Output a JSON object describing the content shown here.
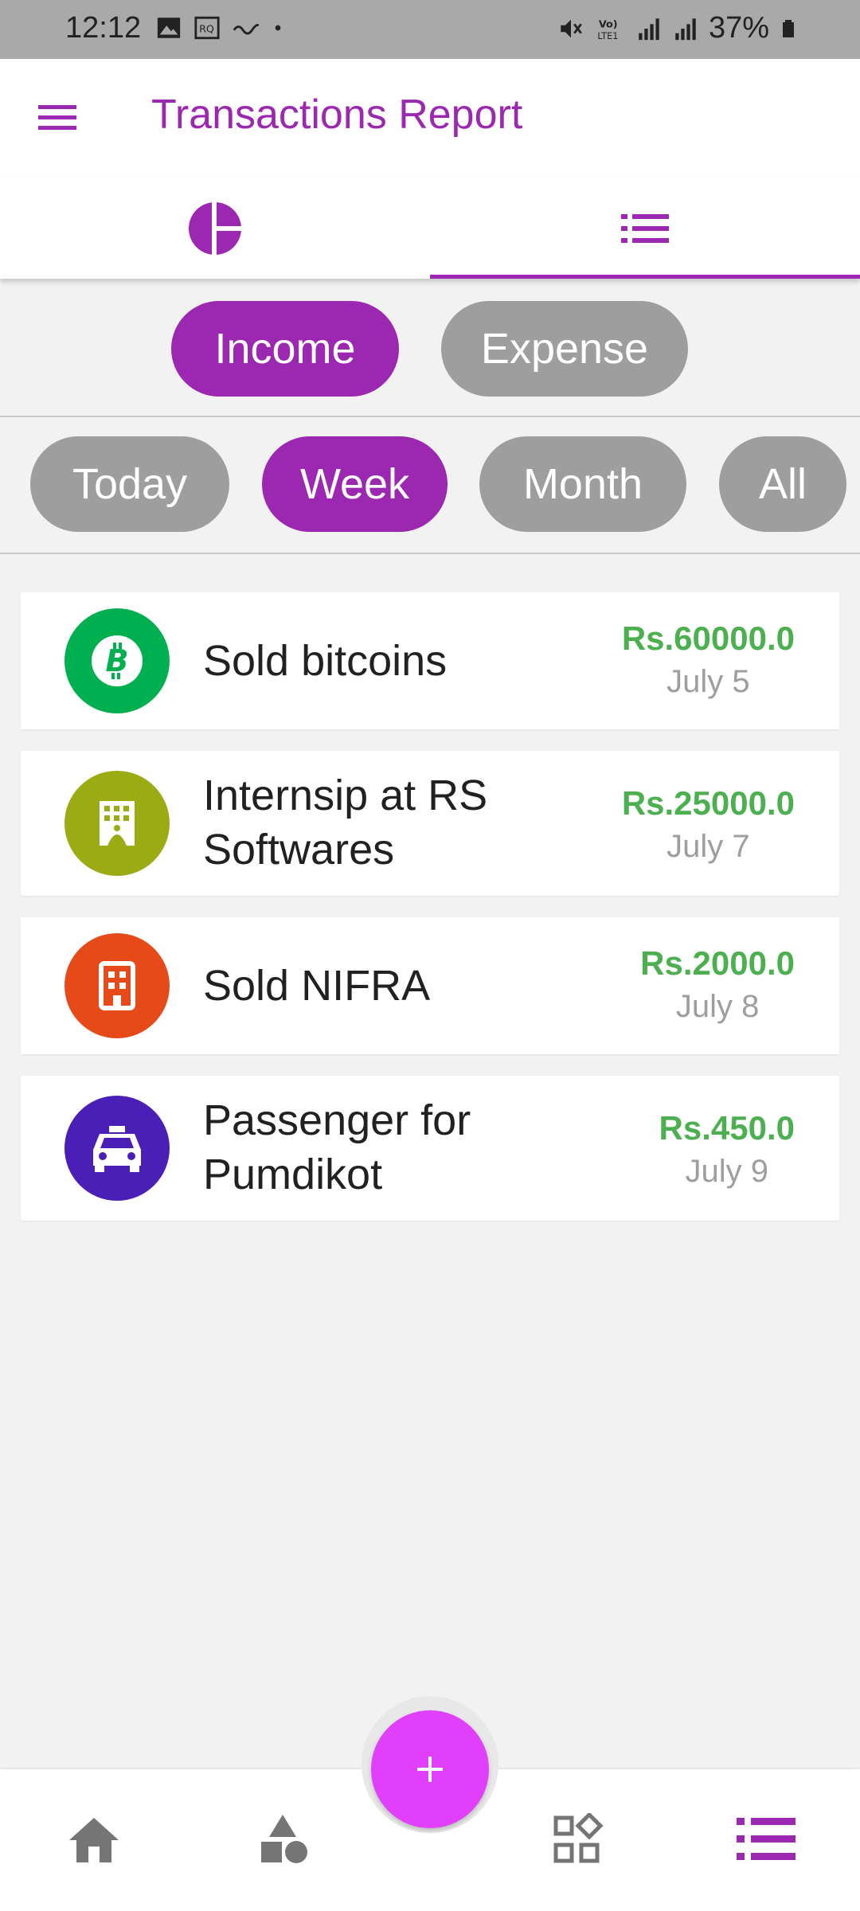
{
  "status_bar": {
    "time": "12:12",
    "battery": "37%",
    "left_icons": [
      "image-icon",
      "rq-icon",
      "wavy-icon",
      "dot-icon"
    ],
    "right_icons": [
      "mute-icon",
      "volte-icon",
      "signal-icon",
      "signal-icon",
      "battery-icon"
    ]
  },
  "app_bar": {
    "title": "Transactions Report",
    "menu_icon": "hamburger-menu-icon"
  },
  "tabs": [
    {
      "icon": "pie-chart-icon",
      "active": false
    },
    {
      "icon": "list-icon",
      "active": true
    }
  ],
  "type_filter": {
    "income": "Income",
    "expense": "Expense",
    "selected": "Income"
  },
  "period_filter": {
    "today": "Today",
    "week": "Week",
    "month": "Month",
    "all": "All",
    "selected": "Week"
  },
  "transactions": [
    {
      "title": "Sold bitcoins",
      "amount": "Rs.60000.0",
      "date": "July 5",
      "icon": "bitcoin-icon",
      "color": "#00b050"
    },
    {
      "title": "Internsip at RS Softwares",
      "amount": "Rs.25000.0",
      "date": "July 7",
      "icon": "office-building-icon",
      "color": "#9aab14"
    },
    {
      "title": "Sold NIFRA",
      "amount": "Rs.2000.0",
      "date": "July 8",
      "icon": "building-icon",
      "color": "#e64a19"
    },
    {
      "title": "Passenger for Pumdikot",
      "amount": "Rs.450.0",
      "date": "July 9",
      "icon": "taxi-icon",
      "color": "#4a1fb8"
    }
  ],
  "colors": {
    "accent": "#9c27b0",
    "fab": "#e040fb",
    "amount": "#4caf50",
    "chip_inactive": "#9e9e9e"
  },
  "bottom_nav": {
    "items": [
      "home-icon",
      "shapes-icon",
      "grid-icon",
      "list-icon"
    ],
    "fab_icon": "plus-icon"
  }
}
